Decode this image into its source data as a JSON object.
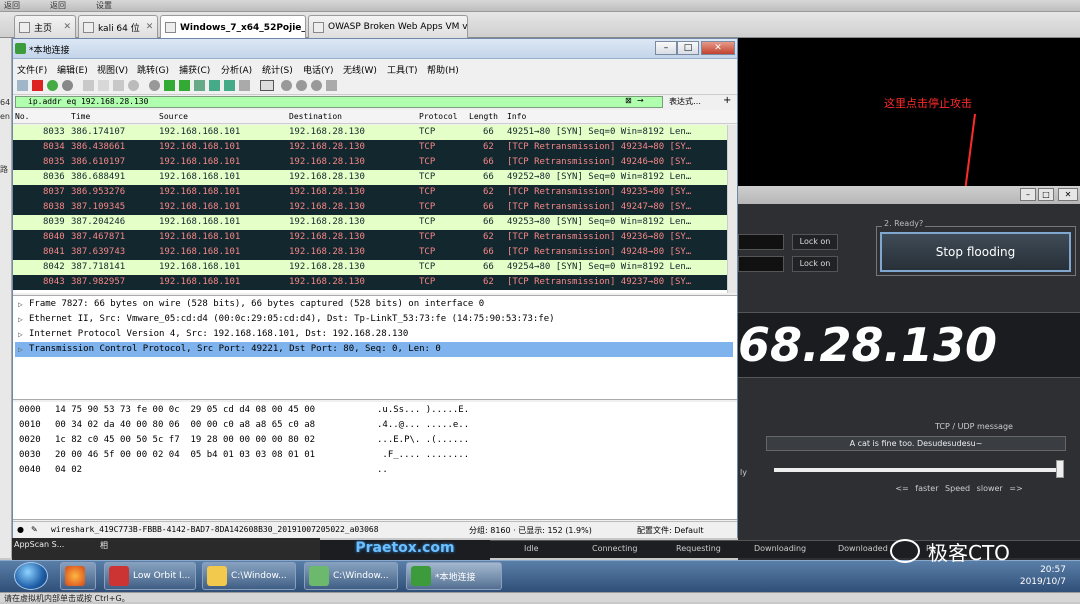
{
  "topbar": {
    "items": [
      "返回",
      "返回",
      "设置"
    ]
  },
  "tabs": [
    {
      "label": "主页",
      "active": false
    },
    {
      "label": "kali 64 位",
      "active": false
    },
    {
      "label": "Windows_7_x64_52Pojie_2",
      "active": true
    },
    {
      "label": "OWASP Broken Web Apps VM v...",
      "active": false
    }
  ],
  "left_strip": {
    "labels": [
      "64",
      "en",
      "路"
    ]
  },
  "attack_tool": {
    "annotation": "这里点击停止攻击",
    "lock_on_1": "Lock on",
    "lock_on_2": "Lock on",
    "ready_label": "2. Ready?",
    "stop_button": "Stop flooding",
    "target_ip_partial": "68.28.130",
    "tcp_label": "TCP / UDP message",
    "tcp_message": "A cat is fine too. Desudesudesu~",
    "ly_label": "ly",
    "speed_label": "<= faster   Speed   slower =>",
    "status": {
      "idle": "Idle",
      "connecting": "Connecting",
      "requesting": "Requesting",
      "downloading": "Downloading",
      "downloaded": "Downloaded",
      "re": "Re"
    },
    "praetox": "Praetox.com",
    "appscan": "AppScan S...",
    "appscan_right": "相"
  },
  "wireshark": {
    "title": "*本地连接",
    "menu": [
      "文件(F)",
      "编辑(E)",
      "视图(V)",
      "跳转(G)",
      "捕获(C)",
      "分析(A)",
      "统计(S)",
      "电话(Y)",
      "无线(W)",
      "工具(T)",
      "帮助(H)"
    ],
    "filter_value": "ip.addr eq 192.168.28.130",
    "filter_expression": "表达式…",
    "columns": {
      "no": "No.",
      "time": "Time",
      "source": "Source",
      "destination": "Destination",
      "protocol": "Protocol",
      "length": "Length",
      "info": "Info"
    },
    "packets": [
      {
        "no": "8033",
        "time": "386.174107",
        "src": "192.168.168.101",
        "dst": "192.168.28.130",
        "proto": "TCP",
        "len": "66",
        "info": "49251→80 [SYN] Seq=0 Win=8192 Len…",
        "type": "syn"
      },
      {
        "no": "8034",
        "time": "386.438661",
        "src": "192.168.168.101",
        "dst": "192.168.28.130",
        "proto": "TCP",
        "len": "62",
        "info": "[TCP Retransmission] 49234→80 [SY…",
        "type": "retx"
      },
      {
        "no": "8035",
        "time": "386.610197",
        "src": "192.168.168.101",
        "dst": "192.168.28.130",
        "proto": "TCP",
        "len": "66",
        "info": "[TCP Retransmission] 49246→80 [SY…",
        "type": "retx"
      },
      {
        "no": "8036",
        "time": "386.688491",
        "src": "192.168.168.101",
        "dst": "192.168.28.130",
        "proto": "TCP",
        "len": "66",
        "info": "49252→80 [SYN] Seq=0 Win=8192 Len…",
        "type": "syn"
      },
      {
        "no": "8037",
        "time": "386.953276",
        "src": "192.168.168.101",
        "dst": "192.168.28.130",
        "proto": "TCP",
        "len": "62",
        "info": "[TCP Retransmission] 49235→80 [SY…",
        "type": "retx"
      },
      {
        "no": "8038",
        "time": "387.109345",
        "src": "192.168.168.101",
        "dst": "192.168.28.130",
        "proto": "TCP",
        "len": "66",
        "info": "[TCP Retransmission] 49247→80 [SY…",
        "type": "retx"
      },
      {
        "no": "8039",
        "time": "387.204246",
        "src": "192.168.168.101",
        "dst": "192.168.28.130",
        "proto": "TCP",
        "len": "66",
        "info": "49253→80 [SYN] Seq=0 Win=8192 Len…",
        "type": "syn"
      },
      {
        "no": "8040",
        "time": "387.467871",
        "src": "192.168.168.101",
        "dst": "192.168.28.130",
        "proto": "TCP",
        "len": "62",
        "info": "[TCP Retransmission] 49236→80 [SY…",
        "type": "retx"
      },
      {
        "no": "8041",
        "time": "387.639743",
        "src": "192.168.168.101",
        "dst": "192.168.28.130",
        "proto": "TCP",
        "len": "66",
        "info": "[TCP Retransmission] 49248→80 [SY…",
        "type": "retx"
      },
      {
        "no": "8042",
        "time": "387.718141",
        "src": "192.168.168.101",
        "dst": "192.168.28.130",
        "proto": "TCP",
        "len": "66",
        "info": "49254→80 [SYN] Seq=0 Win=8192 Len…",
        "type": "syn"
      },
      {
        "no": "8043",
        "time": "387.982957",
        "src": "192.168.168.101",
        "dst": "192.168.28.130",
        "proto": "TCP",
        "len": "62",
        "info": "[TCP Retransmission] 49237→80 [SY…",
        "type": "retx"
      }
    ],
    "details": [
      "Frame 7827: 66 bytes on wire (528 bits), 66 bytes captured (528 bits) on interface 0",
      "Ethernet II, Src: Vmware_05:cd:d4 (00:0c:29:05:cd:d4), Dst: Tp-LinkT_53:73:fe (14:75:90:53:73:fe)",
      "Internet Protocol Version 4, Src: 192.168.168.101, Dst: 192.168.28.130",
      "Transmission Control Protocol, Src Port: 49221, Dst Port: 80, Seq: 0, Len: 0"
    ],
    "hex": [
      {
        "off": "0000",
        "bytes": "14 75 90 53 73 fe 00 0c  29 05 cd d4 08 00 45 00",
        "ascii": ".u.Ss... ).....E."
      },
      {
        "off": "0010",
        "bytes": "00 34 02 da 40 00 80 06  00 00 c0 a8 a8 65 c0 a8",
        "ascii": ".4..@... .....e.."
      },
      {
        "off": "0020",
        "bytes": "1c 82 c0 45 00 50 5c f7  19 28 00 00 00 00 80 02",
        "ascii": "...E.P\\. .(......"
      },
      {
        "off": "0030",
        "bytes": "20 00 46 5f 00 00 02 04  05 b4 01 03 03 08 01 01",
        "ascii": " .F_.... ........"
      },
      {
        "off": "0040",
        "bytes": "04 02",
        "ascii": ".."
      }
    ],
    "status": {
      "file": "wireshark_419C773B-FBBB-4142-BAD7-8DA142608B30_20191007205022_a03068",
      "packets": "分组: 8160 · 已显示: 152 (1.9%)",
      "profile": "配置文件: Default"
    }
  },
  "taskbar": {
    "items": [
      "Low Orbit I...",
      "C:\\Window...",
      "C:\\Window...",
      "*本地连接"
    ],
    "time": "20:57",
    "date": "2019/10/7"
  },
  "watermark": "极客CTO",
  "bottom_hint": "请在虚拟机内部单击或按 Ctrl+G。"
}
